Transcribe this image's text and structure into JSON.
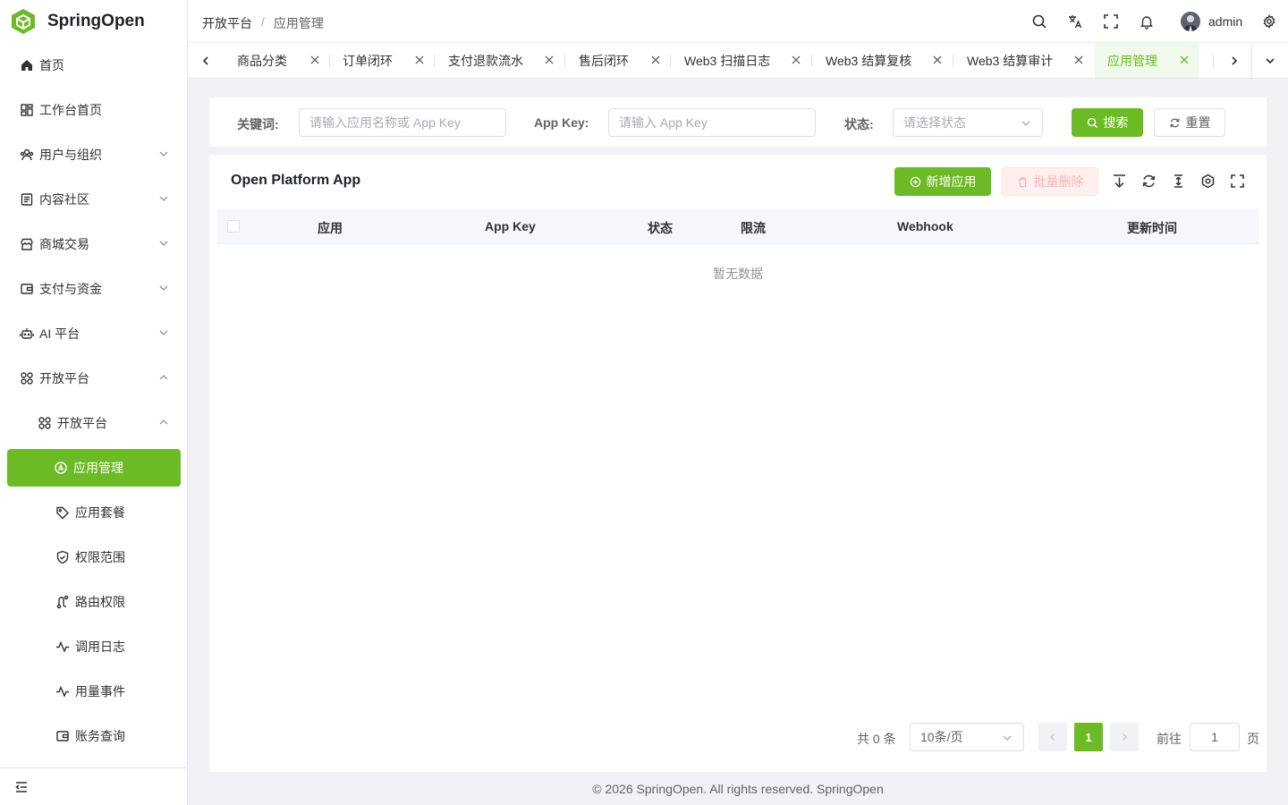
{
  "app": {
    "name": "SpringOpen",
    "brand_color": "#6cba26"
  },
  "sidebar": {
    "items": [
      {
        "label": "首页",
        "icon": "home-icon"
      },
      {
        "label": "工作台首页",
        "icon": "dashboard-grid-icon"
      },
      {
        "label": "用户与组织",
        "icon": "users-icon",
        "expandable": true,
        "expanded": false
      },
      {
        "label": "内容社区",
        "icon": "document-icon",
        "expandable": true,
        "expanded": false
      },
      {
        "label": "商城交易",
        "icon": "store-icon",
        "expandable": true,
        "expanded": false
      },
      {
        "label": "支付与资金",
        "icon": "wallet-icon",
        "expandable": true,
        "expanded": false
      },
      {
        "label": "AI 平台",
        "icon": "robot-icon",
        "expandable": true,
        "expanded": false
      },
      {
        "label": "开放平台",
        "icon": "apps-icon",
        "expandable": true,
        "expanded": true
      }
    ],
    "submenu": {
      "label": "开放平台",
      "icon": "apps-icon",
      "expanded": true
    },
    "children": [
      {
        "label": "应用管理",
        "icon": "app-icon",
        "active": true
      },
      {
        "label": "应用套餐",
        "icon": "tag-icon"
      },
      {
        "label": "权限范围",
        "icon": "shield-check-icon"
      },
      {
        "label": "路由权限",
        "icon": "route-icon"
      },
      {
        "label": "调用日志",
        "icon": "activity-icon"
      },
      {
        "label": "用量事件",
        "icon": "activity-icon"
      },
      {
        "label": "账务查询",
        "icon": "wallet-icon"
      }
    ]
  },
  "header": {
    "breadcrumb": [
      "开放平台",
      "应用管理"
    ],
    "separator": "/",
    "username": "admin"
  },
  "tabs": [
    {
      "label": "商品分类"
    },
    {
      "label": "订单闭环"
    },
    {
      "label": "支付退款流水"
    },
    {
      "label": "售后闭环"
    },
    {
      "label": "Web3 扫描日志"
    },
    {
      "label": "Web3 结算复核"
    },
    {
      "label": "Web3 结算审计"
    },
    {
      "label": "应用管理",
      "active": true
    }
  ],
  "filters": {
    "keyword_label": "关键词:",
    "keyword_placeholder": "请输入应用名称或 App Key",
    "appkey_label": "App Key:",
    "appkey_placeholder": "请输入 App Key",
    "status_label": "状态:",
    "status_placeholder": "请选择状态",
    "search_label": "搜索",
    "reset_label": "重置"
  },
  "table": {
    "title": "Open Platform App",
    "add_label": "新增应用",
    "batch_delete_label": "批量删除",
    "columns": [
      "应用",
      "App Key",
      "状态",
      "限流",
      "Webhook",
      "更新时间"
    ],
    "empty_text": "暂无数据"
  },
  "pagination": {
    "total_text": "共 0 条",
    "page_size": "10条/页",
    "current_page": "1",
    "goto_label": "前往",
    "goto_value": "1",
    "page_suffix": "页"
  },
  "footer": {
    "text": "© 2026 SpringOpen. All rights reserved. SpringOpen"
  }
}
